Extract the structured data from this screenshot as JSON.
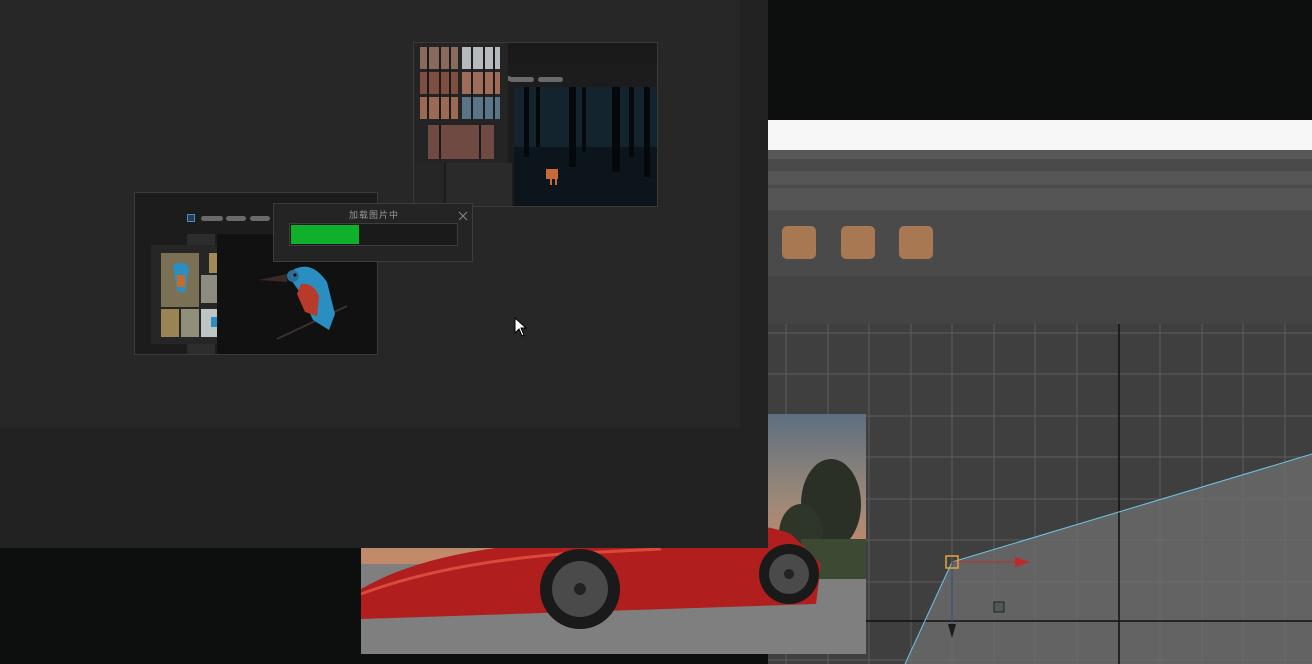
{
  "progress_dialog": {
    "title": "加载图片中",
    "progress_fraction": 0.41,
    "fill_color": "#0fb12a",
    "close_icon": "close-icon"
  },
  "swatch_color": "#a77852",
  "curve_line_color": "#6ec6e6",
  "icons": {
    "cursor": "mouse-pointer-icon",
    "x_axis_handle": "arrow-right-icon",
    "y_axis_handle": "arrow-down-icon"
  }
}
